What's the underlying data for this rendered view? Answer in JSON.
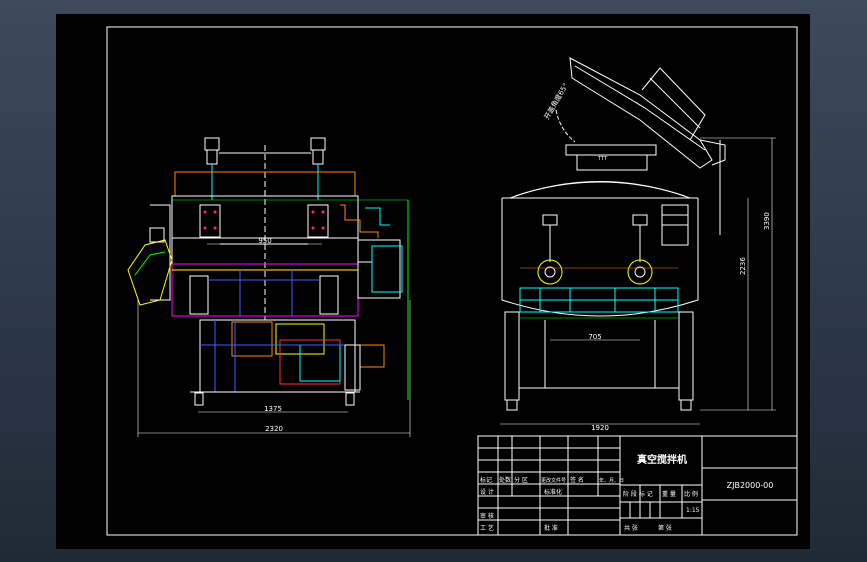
{
  "drawing": {
    "title": "真空搅拌机",
    "code": "ZJB2000-00"
  },
  "dimensions": {
    "inner_width": "950",
    "base_length": "1375",
    "overall_length": "2320",
    "blade_spacing": "705",
    "overall_width": "1920",
    "height_lower": "2236",
    "height_total": "3390",
    "lid_angle": "开盖角度65°"
  },
  "title_block": {
    "labels": {
      "mark": "标记",
      "count": "处数",
      "zone": "分 区",
      "doc_no": "更改文件号",
      "sign_date": "签 名",
      "year_month_day": "年、月、日",
      "design": "设 计",
      "standardize": "标准化",
      "stage_mark": "阶 段 标 记",
      "weight": "重 量",
      "scale": "比 例",
      "review": "审 核",
      "process": "工 艺",
      "approve": "批 准",
      "sheets_total": "共 张",
      "sheet_no": "第 张"
    },
    "scale_value": "1:15"
  },
  "colors": {
    "background": "#000000",
    "outline": "#ffffff",
    "cyan": "#00ffff",
    "yellow": "#ffff00",
    "magenta": "#ff00ff",
    "red": "#ff3030",
    "green": "#00ff00",
    "blue": "#4060ff",
    "orange": "#ff8800"
  }
}
